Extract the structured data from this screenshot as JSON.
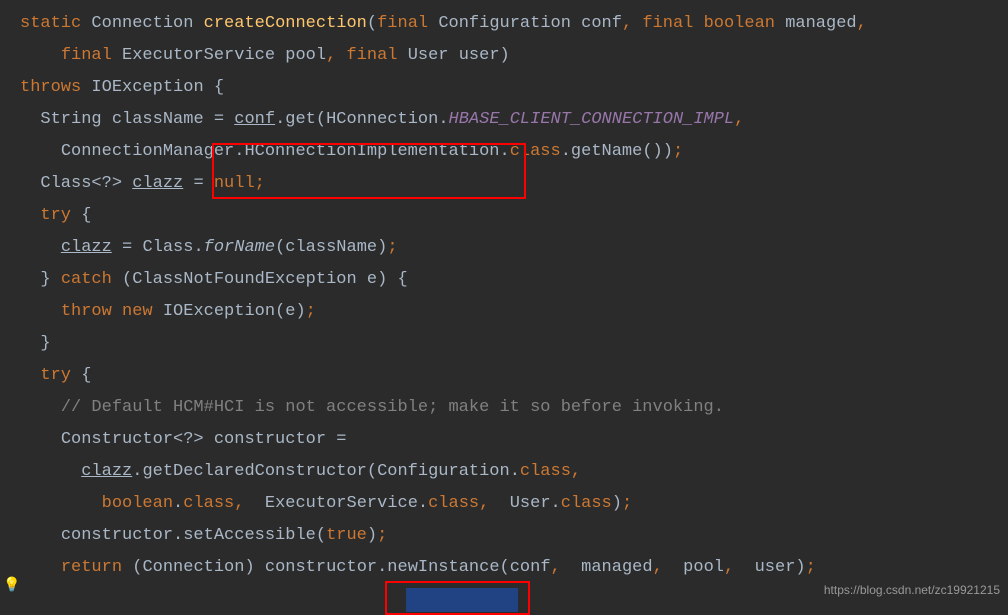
{
  "code": {
    "line1": {
      "static": "static",
      "type1": "Connection",
      "method": "createConnection",
      "paren1": "(",
      "final1": "final",
      "type2": "Configuration",
      "param1": "conf",
      "comma1": ",",
      "final2": "final",
      "type3": "boolean",
      "param2": "managed",
      "comma2": ","
    },
    "line2": {
      "final": "final",
      "type1": "ExecutorService",
      "param1": "pool",
      "comma": ",",
      "final2": "final",
      "type2": "User",
      "param2": "user",
      "paren": ")"
    },
    "line3": {
      "throws": "throws",
      "exc": "IOException",
      "brace": "{"
    },
    "line4": {
      "type": "String",
      "var": "className",
      "eq": "=",
      "obj": "conf",
      "dot1": ".",
      "get": "get",
      "paren": "(",
      "cls": "HConnection",
      "dot2": ".",
      "const": "HBASE_CLIENT_CONNECTION_IMPL",
      "comma": ","
    },
    "line5": {
      "cls1": "ConnectionManager",
      "dot1": ".",
      "cls2": "HConnectionImplementation",
      "dot2": ".",
      "class": "class",
      "dot3": ".",
      "method": "getName",
      "parens": "())",
      "semi": ";"
    },
    "line6": {
      "type": "Class<?>",
      "var": "clazz",
      "eq": "=",
      "null": "null",
      "semi": ";"
    },
    "line7": {
      "try": "try",
      "brace": "{"
    },
    "line8": {
      "var": "clazz",
      "eq": "=",
      "cls": "Class",
      "dot": ".",
      "method": "forName",
      "paren1": "(",
      "arg": "className",
      "paren2": ")",
      "semi": ";"
    },
    "line9": {
      "brace": "}",
      "catch": "catch",
      "paren1": "(",
      "type": "ClassNotFoundException",
      "var": "e",
      "paren2": ")",
      "brace2": "{"
    },
    "line10": {
      "throw": "throw",
      "new": "new",
      "type": "IOException",
      "paren1": "(",
      "arg": "e",
      "paren2": ")",
      "semi": ";"
    },
    "line11": {
      "brace": "}"
    },
    "line12": {
      "try": "try",
      "brace": "{"
    },
    "line13": {
      "comment": "// Default HCM#HCI is not accessible; make it so before invoking."
    },
    "line14": {
      "type": "Constructor<?>",
      "var": "constructor",
      "eq": "="
    },
    "line15": {
      "var": "clazz",
      "dot": ".",
      "method": "getDeclaredConstructor",
      "paren": "(",
      "type1": "Configuration",
      "dot1": ".",
      "class1": "class",
      "comma": ","
    },
    "line16": {
      "type1": "boolean",
      "dot1": ".",
      "class1": "class",
      "comma1": ",",
      "type2": "ExecutorService",
      "dot2": ".",
      "class2": "class",
      "comma2": ",",
      "type3": "User",
      "dot3": ".",
      "class3": "class",
      "paren": ")",
      "semi": ";"
    },
    "line17": {
      "var": "constructor",
      "dot": ".",
      "method": "setAccessible",
      "paren1": "(",
      "arg": "true",
      "paren2": ")",
      "semi": ";"
    },
    "line18": {
      "return": "return",
      "paren1": "(",
      "cast": "Connection",
      "paren2": ")",
      "var": "constructor",
      "dot": ".",
      "method": "newInstance",
      "paren3": "(",
      "arg1": "conf",
      "comma1": ",",
      "arg2": "managed",
      "comma2": ",",
      "arg3": "pool",
      "comma3": ",",
      "arg4": "user",
      "paren4": ")",
      "semi": ";"
    }
  },
  "watermark": "https://blog.csdn.net/zc19921215",
  "icons": {
    "bulb": "💡"
  }
}
